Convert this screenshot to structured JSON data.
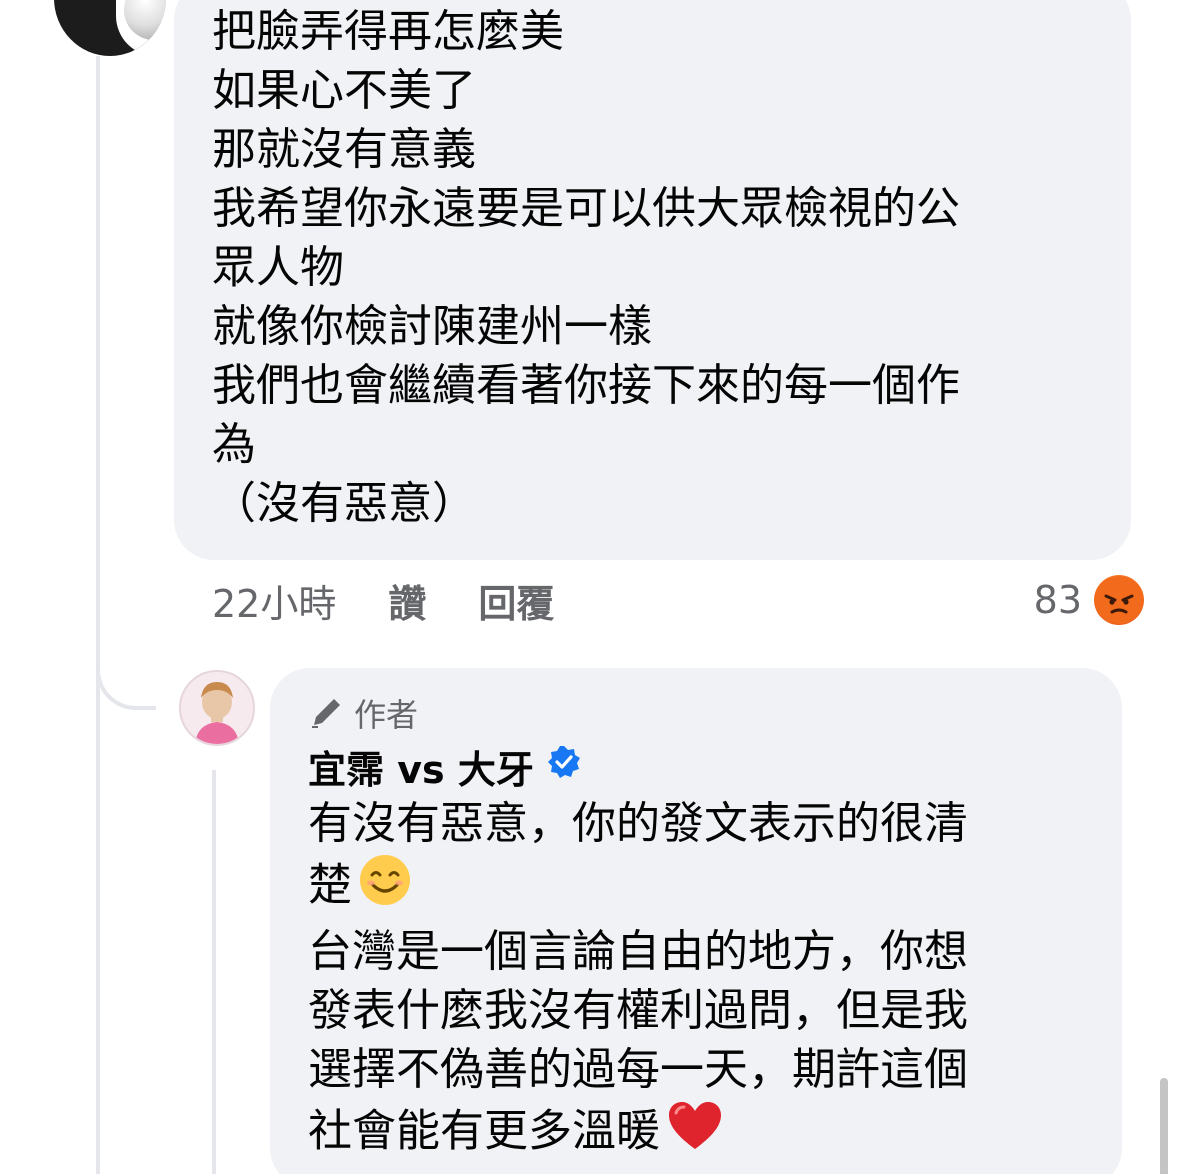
{
  "comment": {
    "lines": [
      "把臉弄得再怎麼美",
      "如果心不美了",
      "那就沒有意義",
      "我希望你永遠要是可以供大眾檢視的公",
      "眾人物",
      "就像你檢討陳建州一樣",
      "我們也會繼續看著你接下來的每一個作",
      "為",
      "（沒有惡意）"
    ],
    "time": "22小時",
    "like_label": "讚",
    "reply_label": "回覆",
    "reaction_count": "83",
    "reaction_icon": "angry-reaction-icon"
  },
  "reply": {
    "badge_label": "作者",
    "author_name": "宜霈 vs 大牙",
    "verified_icon": "verified-badge-icon",
    "lines": [
      "有沒有惡意，你的發文表示的很清",
      "楚",
      "台灣是一個言論自由的地方，你想",
      "發表什麼我沒有權利過問，但是我",
      "選擇不偽善的過每一天，期許這個",
      "社會能有更多溫暖"
    ],
    "emoji_smile": "smiling-face-emoji",
    "emoji_heart": "red-heart-emoji"
  },
  "colors": {
    "bubble": "#f0f2f5",
    "meta_text": "#65676b",
    "verified": "#1877f2",
    "angry": "#f26a1b",
    "heart": "#e0242e"
  }
}
